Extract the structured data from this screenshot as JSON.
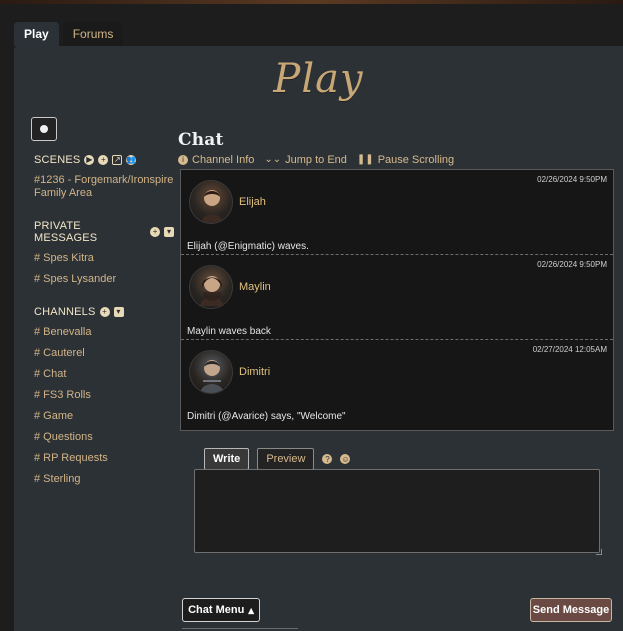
{
  "tabs": [
    {
      "label": "Play",
      "active": true
    },
    {
      "label": "Forums",
      "active": false
    }
  ],
  "page": {
    "title": "Play"
  },
  "sidebar": {
    "scenes": {
      "title": "SCENES",
      "items": [
        "#1236 - Forgemark/Ironspire Family Area"
      ]
    },
    "private_messages": {
      "title": "PRIVATE MESSAGES",
      "items": [
        "# Spes Kitra",
        "# Spes Lysander"
      ]
    },
    "channels": {
      "title": "CHANNELS",
      "items": [
        "# Benevalla",
        "# Cauterel",
        "# Chat",
        "# FS3 Rolls",
        "# Game",
        "# Questions",
        "# RP Requests",
        "# Sterling"
      ]
    }
  },
  "chat": {
    "title": "Chat",
    "tools": {
      "channel_info": "Channel Info",
      "jump_to_end": "Jump to End",
      "pause_scrolling": "Pause Scrolling"
    },
    "messages": [
      {
        "timestamp": "02/26/2024 9:50PM",
        "name": "Elijah",
        "text": "Elijah (@Enigmatic) waves."
      },
      {
        "timestamp": "02/26/2024 9:50PM",
        "name": "Maylin",
        "text": "Maylin waves back"
      },
      {
        "timestamp": "02/27/2024 12:05AM",
        "name": "Dimitri",
        "text": "Dimitri (@Avarice) says, \"Welcome\""
      }
    ]
  },
  "editor": {
    "write_tab": "Write",
    "preview_tab": "Preview",
    "textarea_value": ""
  },
  "buttons": {
    "chat_menu": "Chat Menu",
    "send_message": "Send Message"
  },
  "icons": {
    "settings": "settings-icon",
    "scenes_play": "play-icon",
    "scenes_add": "plus-icon",
    "scenes_share": "share-icon",
    "scenes_people": "people-icon",
    "pm_add": "plus-icon",
    "pm_dropdown": "caret-down-icon",
    "channels_add": "plus-icon",
    "channels_dropdown": "caret-down-icon",
    "info": "info-icon",
    "jump": "double-chevron-down-icon",
    "pause": "pause-icon",
    "help": "question-icon",
    "emoji": "emoji-icon",
    "chat_menu_caret": "caret-up-icon"
  },
  "colors": {
    "panel_bg": "#2c3136",
    "accent_gold": "#d6b98c",
    "send_bg": "#6a4a43"
  }
}
